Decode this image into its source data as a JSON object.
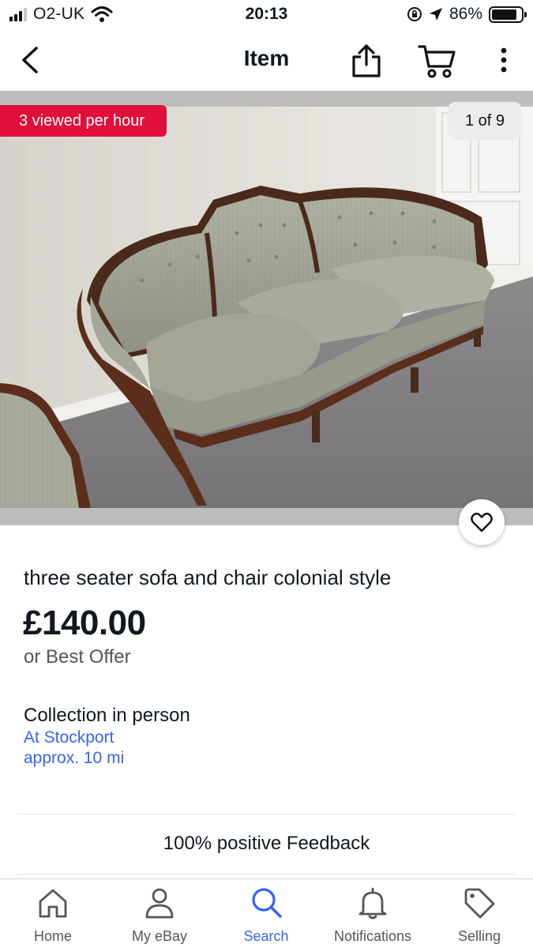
{
  "status": {
    "carrier": "O2-UK",
    "time": "20:13",
    "battery_percent": "86%",
    "battery_level": 0.86
  },
  "nav": {
    "title": "Item",
    "icons": [
      "chevron-left-icon",
      "share-icon",
      "cart-icon",
      "more-vertical-icon"
    ]
  },
  "gallery": {
    "viewed_badge": "3 viewed per hour",
    "counter": "1 of 9",
    "image_subject": "sofa-photo"
  },
  "listing": {
    "title": "three seater sofa and chair colonial style",
    "price": "£140.00",
    "offer_text": "or Best Offer",
    "collection_label": "Collection in person",
    "location": "At Stockport",
    "distance": "approx. 10 mi",
    "feedback": "100% positive Feedback"
  },
  "tabs": [
    {
      "label": "Home",
      "icon": "home-icon",
      "active": false
    },
    {
      "label": "My eBay",
      "icon": "person-icon",
      "active": false
    },
    {
      "label": "Search",
      "icon": "search-icon",
      "active": true
    },
    {
      "label": "Notifications",
      "icon": "bell-icon",
      "active": false
    },
    {
      "label": "Selling",
      "icon": "tag-icon",
      "active": false
    }
  ],
  "colors": {
    "accent_blue": "#3665f3",
    "badge_red": "#e0103a",
    "text_dark": "#111820"
  }
}
